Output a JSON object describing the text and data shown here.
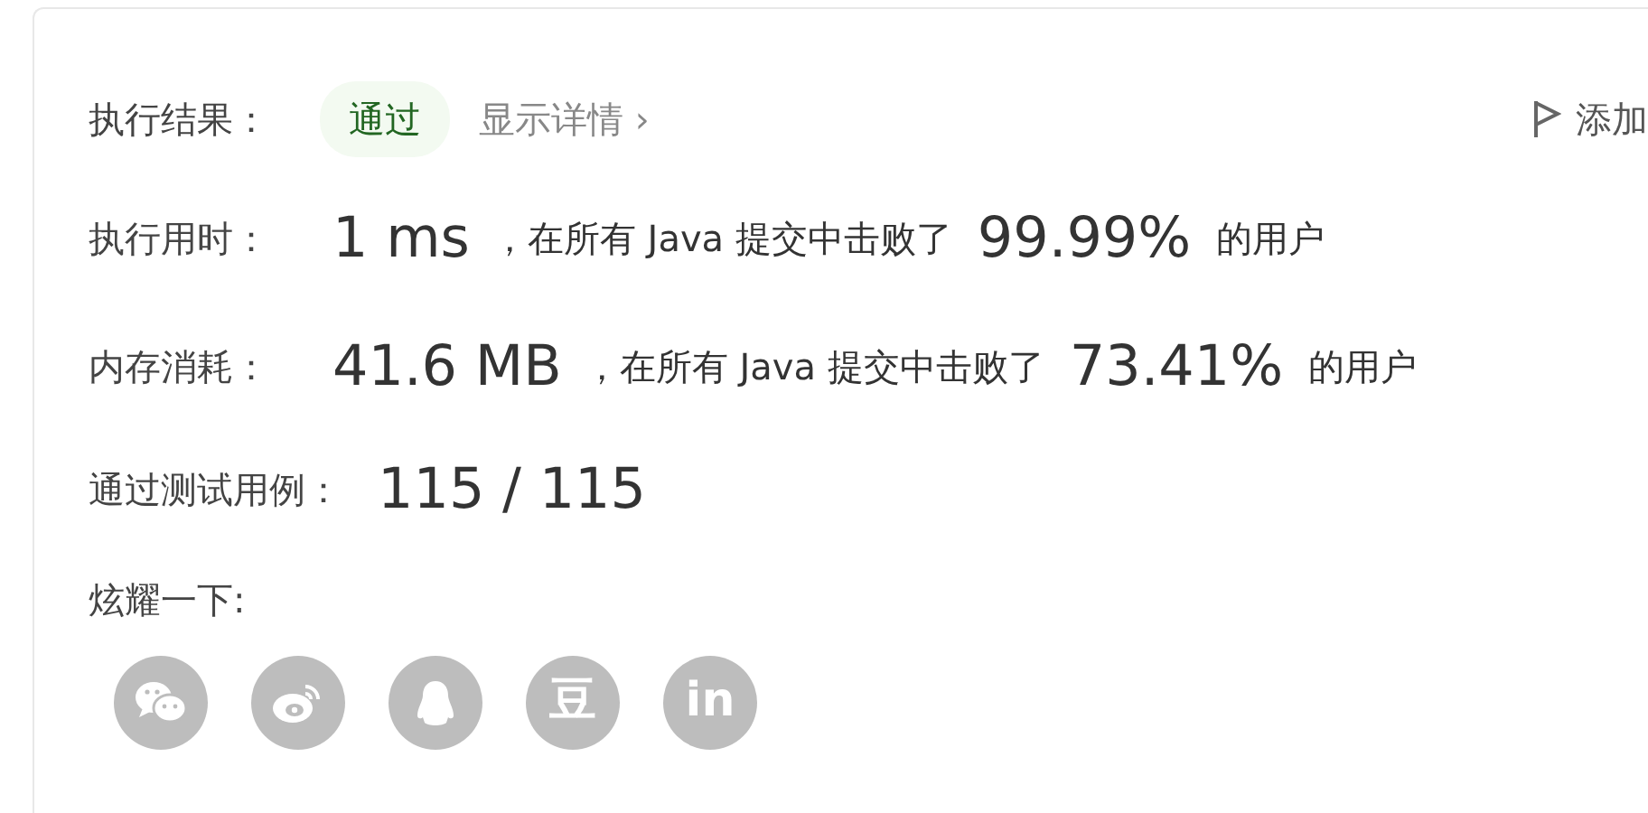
{
  "result": {
    "label": "执行结果：",
    "status": "通过",
    "details_link": "显示详情",
    "details_arrow": "›",
    "add_note": "添加"
  },
  "stats": [
    {
      "label": "执行用时：",
      "value": "1 ms",
      "mid_text": "，在所有 Java 提交中击败了",
      "percent": "99.99%",
      "end_text": "的用户"
    },
    {
      "label": "内存消耗：",
      "value": "41.6 MB",
      "mid_text": "，在所有 Java 提交中击败了",
      "percent": "73.41%",
      "end_text": "的用户"
    }
  ],
  "tests": {
    "label": "通过测试用例：",
    "value": "115 / 115"
  },
  "share": {
    "label": "炫耀一下:",
    "buttons": [
      {
        "kind": "bubbles"
      },
      {
        "kind": "swirl"
      },
      {
        "kind": "penguin"
      },
      {
        "kind": "glyph",
        "text": "豆"
      },
      {
        "kind": "glyph",
        "text": "in"
      }
    ]
  }
}
